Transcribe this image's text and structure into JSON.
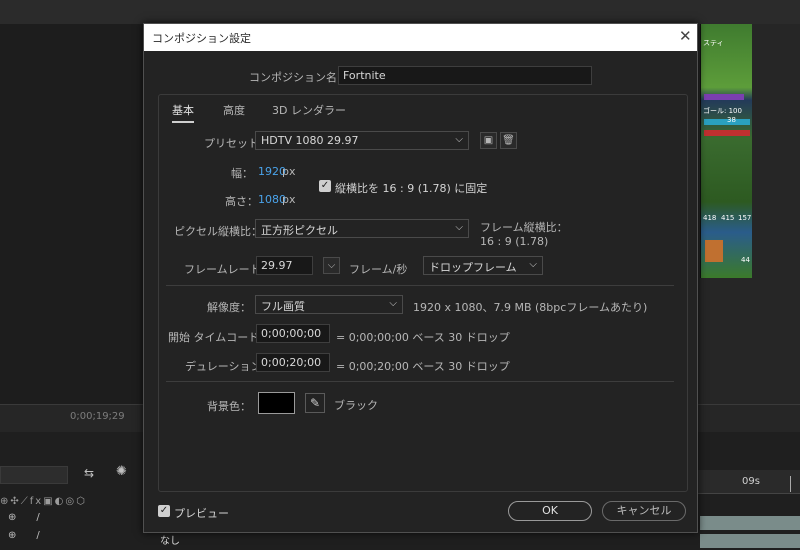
{
  "background": {
    "timecode": "0;00;19;29",
    "ruler_label": "09s",
    "layer_switch_none": "なし",
    "game_hud": {
      "player": "スティ",
      "goal": "ゴール: 100",
      "ammo": "38",
      "counts": [
        "418",
        "415",
        "157"
      ],
      "level": "44"
    }
  },
  "dialog": {
    "title": "コンポジション設定",
    "name_label": "コンポジション名：",
    "name_value": "Fortnite",
    "tabs": [
      {
        "label": "基本",
        "active": true
      },
      {
        "label": "高度",
        "active": false
      },
      {
        "label": "3D レンダラー",
        "active": false
      }
    ],
    "preset_label": "プリセット：",
    "preset_value": "HDTV 1080 29.97",
    "width_label": "幅：",
    "width_value": "1920",
    "width_unit": "px",
    "height_label": "高さ：",
    "height_value": "1080",
    "height_unit": "px",
    "lock_aspect_label": "縦横比を 16 : 9 (1.78) に固定",
    "lock_aspect_checked": true,
    "pixel_aspect_label": "ピクセル縦横比：",
    "pixel_aspect_value": "正方形ピクセル",
    "frame_aspect_label": "フレーム縦横比：",
    "frame_aspect_value": "16 : 9 (1.78)",
    "framerate_label": "フレームレート：",
    "framerate_value": "29.97",
    "framerate_unit": "フレーム/秒",
    "drop_frame_value": "ドロップフレーム",
    "resolution_label": "解像度：",
    "resolution_value": "フル画質",
    "resolution_info": "1920 x 1080、7.9 MB (8bpcフレームあたり)",
    "start_tc_label": "開始 タイムコード：",
    "start_tc_value": "0;00;00;00",
    "start_tc_info": "= 0;00;00;00  ベース 30  ドロップ",
    "duration_label": "デュレーション：",
    "duration_value": "0;00;20;00",
    "duration_info": "= 0;00;20;00  ベース 30  ドロップ",
    "bg_color_label": "背景色：",
    "bg_color_name": "ブラック",
    "bg_color_hex": "#000000",
    "preview_label": "プレビュー",
    "preview_checked": true,
    "ok_label": "OK",
    "cancel_label": "キャンセル"
  }
}
